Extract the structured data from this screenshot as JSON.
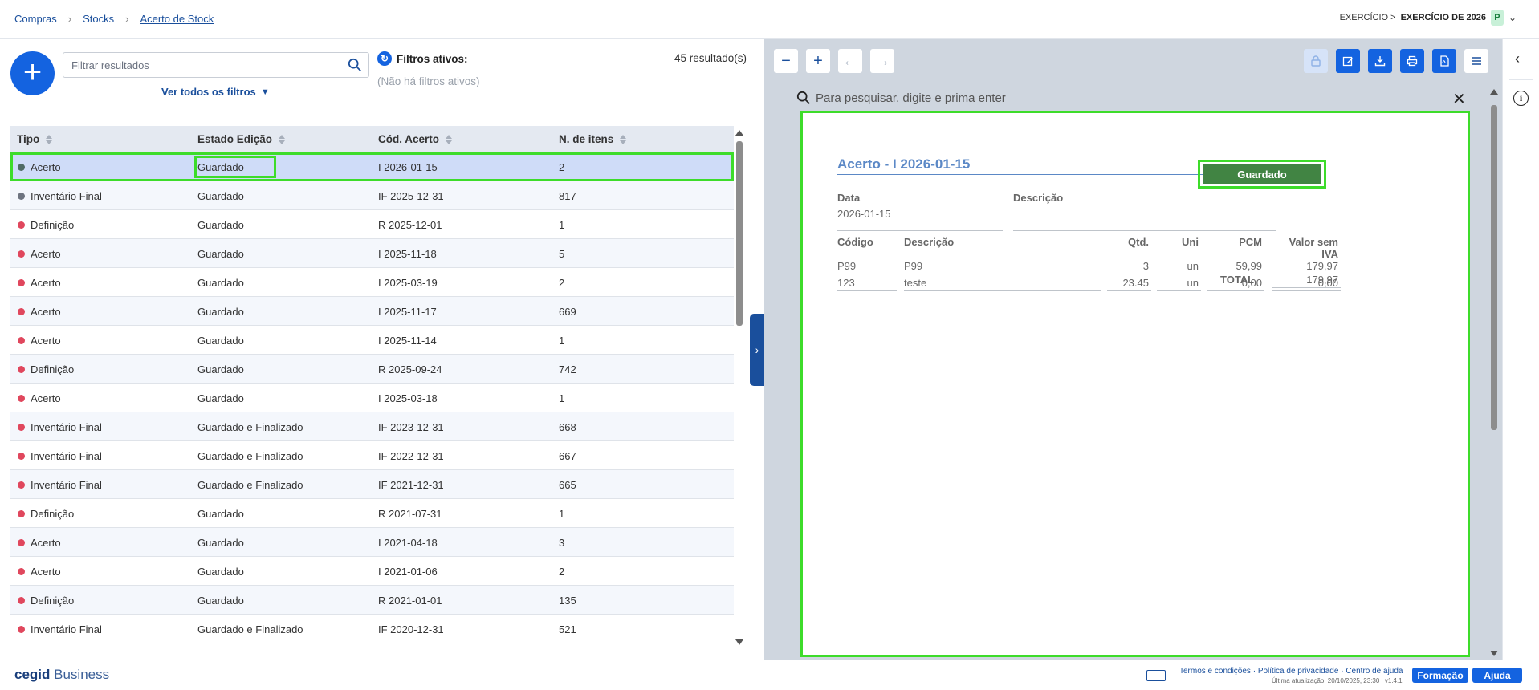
{
  "breadcrumb": {
    "item1": "Compras",
    "item2": "Stocks",
    "current": "Acerto de Stock"
  },
  "exercise": {
    "prefix": "EXERCÍCIO >",
    "value": "EXERCÍCIO DE 2026",
    "badge": "P"
  },
  "list": {
    "search_placeholder": "Filtrar resultados",
    "all_filters": "Ver todos os filtros",
    "filters_title": "Filtros ativos:",
    "no_filters": "(Não há filtros ativos)",
    "result_count": "45 resultado(s)",
    "columns": [
      "Tipo",
      "Estado Edição",
      "Cód. Acerto",
      "N. de itens"
    ],
    "rows": [
      {
        "tipo": "Acerto",
        "estado": "Guardado",
        "cod": "I 2026-01-15",
        "itens": "2",
        "dot": "#4f6b66"
      },
      {
        "tipo": "Inventário Final",
        "estado": "Guardado",
        "cod": "IF 2025-12-31",
        "itens": "817",
        "dot": "#6e7480"
      },
      {
        "tipo": "Definição",
        "estado": "Guardado",
        "cod": "R 2025-12-01",
        "itens": "1",
        "dot": "#e0475d"
      },
      {
        "tipo": "Acerto",
        "estado": "Guardado",
        "cod": "I 2025-11-18",
        "itens": "5",
        "dot": "#e0475d"
      },
      {
        "tipo": "Acerto",
        "estado": "Guardado",
        "cod": "I 2025-03-19",
        "itens": "2",
        "dot": "#e0475d"
      },
      {
        "tipo": "Acerto",
        "estado": "Guardado",
        "cod": "I 2025-11-17",
        "itens": "669",
        "dot": "#e0475d"
      },
      {
        "tipo": "Acerto",
        "estado": "Guardado",
        "cod": "I 2025-11-14",
        "itens": "1",
        "dot": "#e0475d"
      },
      {
        "tipo": "Definição",
        "estado": "Guardado",
        "cod": "R 2025-09-24",
        "itens": "742",
        "dot": "#e0475d"
      },
      {
        "tipo": "Acerto",
        "estado": "Guardado",
        "cod": "I 2025-03-18",
        "itens": "1",
        "dot": "#e0475d"
      },
      {
        "tipo": "Inventário Final",
        "estado": "Guardado e Finalizado",
        "cod": "IF 2023-12-31",
        "itens": "668",
        "dot": "#e0475d"
      },
      {
        "tipo": "Inventário Final",
        "estado": "Guardado e Finalizado",
        "cod": "IF 2022-12-31",
        "itens": "667",
        "dot": "#e0475d"
      },
      {
        "tipo": "Inventário Final",
        "estado": "Guardado e Finalizado",
        "cod": "IF 2021-12-31",
        "itens": "665",
        "dot": "#e0475d"
      },
      {
        "tipo": "Definição",
        "estado": "Guardado",
        "cod": "R 2021-07-31",
        "itens": "1",
        "dot": "#e0475d"
      },
      {
        "tipo": "Acerto",
        "estado": "Guardado",
        "cod": "I 2021-04-18",
        "itens": "3",
        "dot": "#e0475d"
      },
      {
        "tipo": "Acerto",
        "estado": "Guardado",
        "cod": "I 2021-01-06",
        "itens": "2",
        "dot": "#e0475d"
      },
      {
        "tipo": "Definição",
        "estado": "Guardado",
        "cod": "R 2021-01-01",
        "itens": "135",
        "dot": "#e0475d"
      },
      {
        "tipo": "Inventário Final",
        "estado": "Guardado e Finalizado",
        "cod": "IF 2020-12-31",
        "itens": "521",
        "dot": "#e0475d"
      }
    ]
  },
  "document": {
    "search_placeholder": "Para pesquisar, digite e prima enter",
    "title": "Acerto - I 2026-01-15",
    "status": "Guardado",
    "data_label": "Data",
    "data_value": "2026-01-15",
    "descricao_label": "Descrição",
    "columns": [
      "Código",
      "Descrição",
      "Qtd.",
      "Uni",
      "PCM",
      "Valor sem IVA"
    ],
    "lines": [
      {
        "codigo": "P99",
        "descricao": "P99",
        "qtd": "3",
        "uni": "un",
        "pcm": "59,99",
        "valor": "179,97"
      },
      {
        "codigo": "123",
        "descricao": "teste",
        "qtd": "23.45",
        "uni": "un",
        "pcm": "0,00",
        "valor": "0,00"
      }
    ],
    "total_label": "TOTAL",
    "total_value": "179,97"
  },
  "footer": {
    "brand_bold": "cegid",
    "brand_rest": " Business",
    "links": "Termos e condições · Política de privacidade · Centro de ajuda",
    "updated": "Última atualização: 20/10/2025, 23:30 | v1.4.1",
    "formacao": "Formação",
    "ajuda": "Ajuda"
  },
  "colors": {
    "accent": "#1463e0",
    "status_green": "#418443",
    "highlight": "#3ddc2a"
  }
}
